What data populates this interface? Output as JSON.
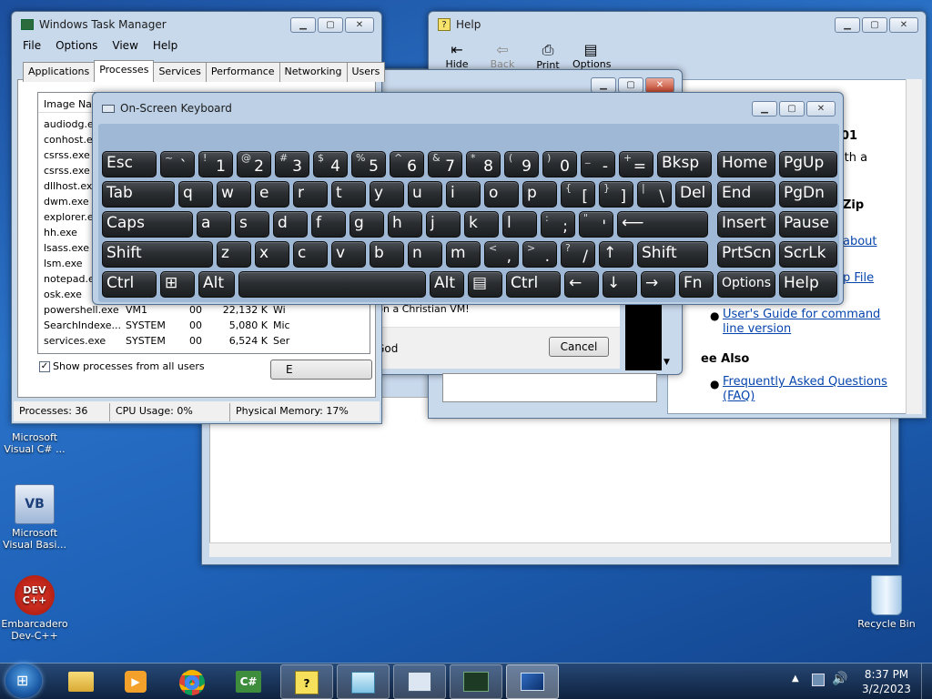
{
  "desktop": {
    "icons": [
      {
        "label": "Microsoft Visual C# ..."
      },
      {
        "label": "Microsoft Visual Basi..."
      },
      {
        "label": "Embarcadero Dev-C++"
      },
      {
        "label": "Recycle Bin"
      }
    ]
  },
  "task_manager": {
    "title": "Windows Task Manager",
    "menu": [
      "File",
      "Options",
      "View",
      "Help"
    ],
    "tabs": [
      "Applications",
      "Processes",
      "Services",
      "Performance",
      "Networking",
      "Users"
    ],
    "active_tab": "Processes",
    "column_header": "Image Nam",
    "rows": [
      {
        "name": "audiodg.ex"
      },
      {
        "name": "conhost.ex"
      },
      {
        "name": "csrss.exe"
      },
      {
        "name": "csrss.exe"
      },
      {
        "name": "dllhost.ex"
      },
      {
        "name": "dwm.exe"
      },
      {
        "name": "explorer.e"
      },
      {
        "name": "hh.exe"
      },
      {
        "name": "lsass.exe"
      },
      {
        "name": "lsm.exe"
      },
      {
        "name": "notepad.e"
      },
      {
        "name": "osk.exe"
      },
      {
        "name": "powershell.exe",
        "user": "VM1",
        "cpu": "00",
        "mem": "22,132 K",
        "desc": "Wi"
      },
      {
        "name": "SearchIndexe...",
        "user": "SYSTEM",
        "cpu": "00",
        "mem": "5,080 K",
        "desc": "Mic"
      },
      {
        "name": "services.exe",
        "user": "SYSTEM",
        "cpu": "00",
        "mem": "6,524 K",
        "desc": "Ser"
      }
    ],
    "show_all_label": "Show processes from all users",
    "end_button": "E",
    "status": {
      "processes": "Processes: 36",
      "cpu": "CPU Usage: 0%",
      "memory": "Physical Memory: 17%"
    }
  },
  "help": {
    "title": "Help",
    "toolbar": [
      "Hide",
      "Back",
      "Print",
      "Options"
    ],
    "text_fragments": [
      "01",
      "ith a",
      "Zip",
      "about",
      "p File"
    ],
    "bullets": [
      {
        "text": "User's Guide for command line version"
      }
    ],
    "see_also": "ee Also",
    "see_also_links": [
      "Frequently Asked Questions (FAQ)"
    ]
  },
  "dialog": {
    "message": "Can't do that on a Christian VM!",
    "checkbox_label": "Pray to God",
    "cancel": "Cancel"
  },
  "osk": {
    "title": "On-Screen Keyboard",
    "rows": [
      [
        {
          "k": "Esc"
        },
        {
          "s": "~",
          "m": "`"
        },
        {
          "s": "!",
          "m": "1"
        },
        {
          "s": "@",
          "m": "2"
        },
        {
          "s": "#",
          "m": "3"
        },
        {
          "s": "$",
          "m": "4"
        },
        {
          "s": "%",
          "m": "5"
        },
        {
          "s": "^",
          "m": "6"
        },
        {
          "s": "&",
          "m": "7"
        },
        {
          "s": "*",
          "m": "8"
        },
        {
          "s": "(",
          "m": "9"
        },
        {
          "s": ")",
          "m": "0"
        },
        {
          "s": "_",
          "m": "-"
        },
        {
          "s": "+",
          "m": "="
        },
        {
          "k": "Bksp"
        }
      ],
      [
        {
          "k": "Tab"
        },
        {
          "k": "q"
        },
        {
          "k": "w"
        },
        {
          "k": "e"
        },
        {
          "k": "r"
        },
        {
          "k": "t"
        },
        {
          "k": "y"
        },
        {
          "k": "u"
        },
        {
          "k": "i"
        },
        {
          "k": "o"
        },
        {
          "k": "p"
        },
        {
          "s": "{",
          "m": "["
        },
        {
          "s": "}",
          "m": "]"
        },
        {
          "s": "|",
          "m": "\\"
        },
        {
          "k": "Del"
        }
      ],
      [
        {
          "k": "Caps"
        },
        {
          "k": "a"
        },
        {
          "k": "s"
        },
        {
          "k": "d"
        },
        {
          "k": "f"
        },
        {
          "k": "g"
        },
        {
          "k": "h"
        },
        {
          "k": "j"
        },
        {
          "k": "k"
        },
        {
          "k": "l"
        },
        {
          "s": ":",
          "m": ";"
        },
        {
          "s": "\"",
          "m": "'"
        },
        {
          "k": "⟵"
        }
      ],
      [
        {
          "k": "Shift"
        },
        {
          "k": "z"
        },
        {
          "k": "x"
        },
        {
          "k": "c"
        },
        {
          "k": "v"
        },
        {
          "k": "b"
        },
        {
          "k": "n"
        },
        {
          "k": "m"
        },
        {
          "s": "<",
          "m": ","
        },
        {
          "s": ">",
          "m": "."
        },
        {
          "s": "?",
          "m": "/"
        },
        {
          "k": "↑"
        },
        {
          "k": "Shift"
        }
      ],
      [
        {
          "k": "Ctrl"
        },
        {
          "k": "⊞"
        },
        {
          "k": "Alt"
        },
        {
          "k": ""
        },
        {
          "k": "Alt"
        },
        {
          "k": "▤"
        },
        {
          "k": "Ctrl"
        },
        {
          "k": "←"
        },
        {
          "k": "↓"
        },
        {
          "k": "→"
        },
        {
          "k": "Fn"
        }
      ]
    ],
    "nav": [
      [
        "Home",
        "PgUp"
      ],
      [
        "End",
        "PgDn"
      ],
      [
        "Insert",
        "Pause"
      ],
      [
        "PrtScn",
        "ScrLk"
      ],
      [
        "Options",
        "Help"
      ]
    ]
  },
  "taskbar": {
    "time": "8:37 PM",
    "date": "3/2/2023"
  }
}
